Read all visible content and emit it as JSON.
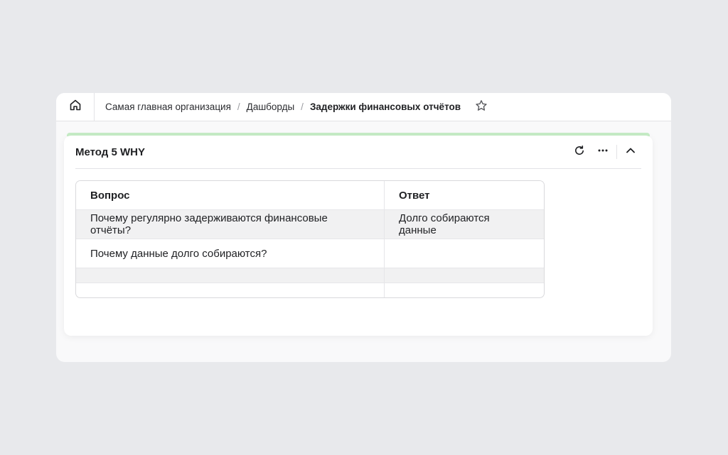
{
  "breadcrumb": {
    "items": [
      "Самая главная организация",
      "Дашборды",
      "Задержки финансовых отчётов"
    ],
    "separator": "/"
  },
  "icons": {
    "home": "home-icon",
    "favorite": "star-icon",
    "refresh": "refresh-icon",
    "more": "more-icon",
    "collapse": "chevron-up-icon"
  },
  "widget": {
    "title": "Метод 5 WHY",
    "accent_color": "#c6ecc6"
  },
  "table": {
    "headers": [
      "Вопрос",
      "Ответ"
    ],
    "rows": [
      [
        "Почему регулярно задерживаются финансовые отчёты?",
        "Долго собираются данные"
      ],
      [
        "Почему данные долго собираются?",
        ""
      ],
      [
        "",
        ""
      ],
      [
        "",
        ""
      ]
    ]
  }
}
